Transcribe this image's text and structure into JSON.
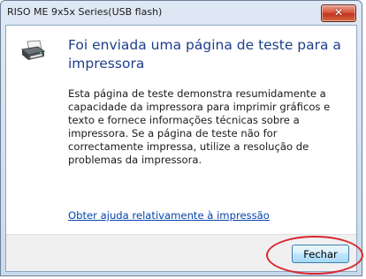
{
  "window": {
    "title": "RISO ME 9x5x Series(USB flash)",
    "close_glyph": "✕"
  },
  "dialog": {
    "heading": "Foi enviada uma página de teste para a impressora",
    "body": "Esta página de teste demonstra resumidamente a capacidade da impressora para imprimir gráficos e texto e fornece informações técnicas sobre a impressora. Se a página de teste não for correctamente impressa, utilize a resolução de problemas da impressora.",
    "help_link": "Obter ajuda relativamente à impressão",
    "icon": "printer-icon"
  },
  "footer": {
    "close_label": "Fechar"
  },
  "annotation": {
    "highlight_color": "#d8262c"
  }
}
